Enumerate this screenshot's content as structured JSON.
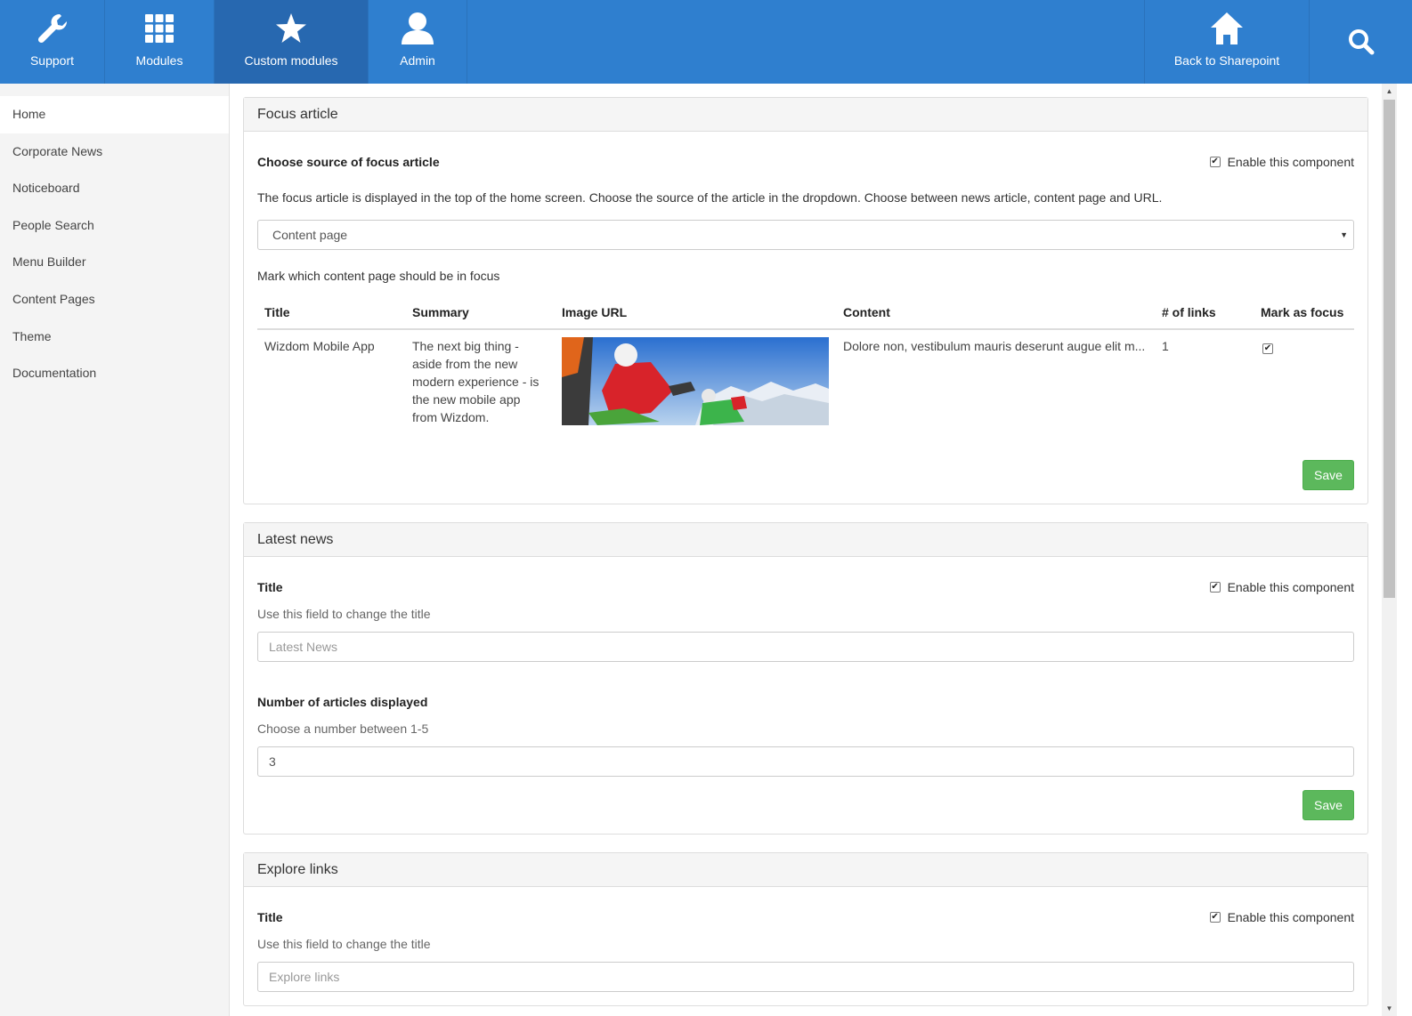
{
  "topnav": {
    "support": "Support",
    "modules": "Modules",
    "custom_modules": "Custom modules",
    "admin": "Admin",
    "back": "Back to Sharepoint"
  },
  "sidebar": {
    "items": [
      {
        "label": "Home"
      },
      {
        "label": "Corporate News"
      },
      {
        "label": "Noticeboard"
      },
      {
        "label": "People Search"
      },
      {
        "label": "Menu Builder"
      },
      {
        "label": "Content Pages"
      },
      {
        "label": "Theme"
      },
      {
        "label": "Documentation"
      }
    ]
  },
  "focus": {
    "title": "Focus article",
    "source_label": "Choose source of focus article",
    "enable": "Enable this component",
    "description": "The focus article is displayed in the top of the home screen. Choose the source of the article in the dropdown. Choose between news article, content page and URL.",
    "select_value": "Content page",
    "mark_label": "Mark which content page should be in focus",
    "table": {
      "headers": [
        "Title",
        "Summary",
        "Image URL",
        "Content",
        "# of links",
        "Mark as focus"
      ],
      "rows": [
        {
          "title": "Wizdom Mobile App",
          "summary": "The next big thing - aside from the new modern experience - is the new mobile app from Wizdom.",
          "content": "Dolore non, vestibulum mauris deserunt augue elit m...",
          "links": "1"
        }
      ]
    },
    "save": "Save"
  },
  "latest": {
    "title": "Latest news",
    "title_label": "Title",
    "enable": "Enable this component",
    "title_help": "Use this field to change the title",
    "title_placeholder": "Latest News",
    "count_label": "Number of articles displayed",
    "count_help": "Choose a number between 1-5",
    "count_value": "3",
    "save": "Save"
  },
  "explore": {
    "title": "Explore links",
    "title_label": "Title",
    "enable": "Enable this component",
    "title_help": "Use this field to change the title",
    "title_placeholder": "Explore links"
  },
  "colors": {
    "topbar": "#2f7fcf",
    "topbar_active": "#2768b0",
    "save": "#5cb85c"
  }
}
